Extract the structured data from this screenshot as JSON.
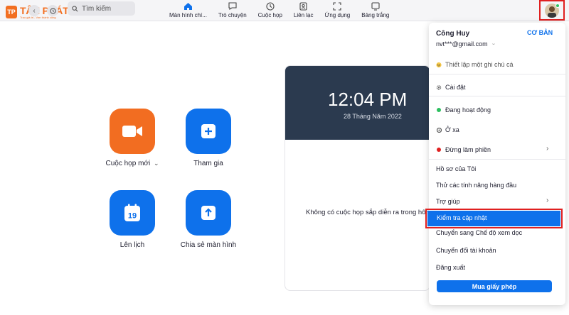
{
  "brand": {
    "name": "TÂN PHÁT",
    "tagline": "Trao giá trị - Vẹn thành công",
    "mark": "TP",
    "accent": "#f26f21"
  },
  "search": {
    "placeholder": "Tìm kiếm"
  },
  "tabs": [
    {
      "label": "Màn hình chí...",
      "icon": "home-icon",
      "active": true
    },
    {
      "label": "Trò chuyện",
      "icon": "chat-icon"
    },
    {
      "label": "Cuộc họp",
      "icon": "clock-icon"
    },
    {
      "label": "Liên lạc",
      "icon": "contacts-icon"
    },
    {
      "label": "Ứng dụng",
      "icon": "apps-icon"
    },
    {
      "label": "Bảng trắng",
      "icon": "whiteboard-icon"
    }
  ],
  "actions": [
    {
      "label": "Cuộc họp mới",
      "icon": "video-camera-icon",
      "color": "#f26d21",
      "has_dropdown": true,
      "dropdown_glyph": "⌄"
    },
    {
      "label": "Tham gia",
      "icon": "plus-icon",
      "color": "#0e71eb"
    },
    {
      "label": "Lên lịch",
      "icon": "calendar-icon",
      "color": "#0e71eb",
      "calendar_day": "19"
    },
    {
      "label": "Chia sẻ màn hình",
      "icon": "share-up-arrow-icon",
      "color": "#0e71eb"
    }
  ],
  "meeting_panel": {
    "time": "12:04 PM",
    "date": "28 Tháng Năm 2022",
    "empty_text": "Không có cuộc họp sắp diễn ra trong hôm"
  },
  "profile_menu": {
    "user_name": "Công Huy",
    "plan": "CƠ BẢN",
    "email": "nvt***@gmail.com",
    "email_glyph": "ᵕ",
    "note_placeholder": "Thiết lập một ghi chú cá",
    "items": {
      "settings": "Cài đặt",
      "status_active": "Đang hoạt động",
      "status_away": "Ở xa",
      "status_dnd": "Đừng làm phiền",
      "profile": "Hồ sơ của Tôi",
      "try_features": "Thử các tính năng hàng đầu",
      "help": "Trợ giúp",
      "check_updates": "Kiểm tra cập nhật",
      "portrait_view": "Chuyển sang Chế độ xem dọc",
      "switch_account": "Chuyển đổi tài khoản",
      "sign_out": "Đăng xuất",
      "buy_license": "Mua giấy phép"
    },
    "status_colors": {
      "active": "#2dbf5f",
      "away": "#555555",
      "dnd": "#e02020"
    },
    "submenu_glyph": "›"
  },
  "highlight_color": "#e02020"
}
